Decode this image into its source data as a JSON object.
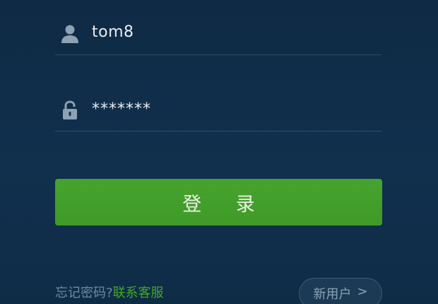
{
  "login_form": {
    "username": {
      "icon": "user-icon",
      "value": "tom8"
    },
    "password": {
      "icon": "lock-icon",
      "value": "*******"
    },
    "login_button_label": "登 录"
  },
  "footer": {
    "forgot_text": "忘记密码?",
    "contact_link": "联系客服",
    "new_user_label": "新用户",
    "new_user_chevron": ">"
  },
  "colors": {
    "background": "#10304d",
    "accent_green": "#43a829",
    "muted_text": "#6f8ba3"
  }
}
